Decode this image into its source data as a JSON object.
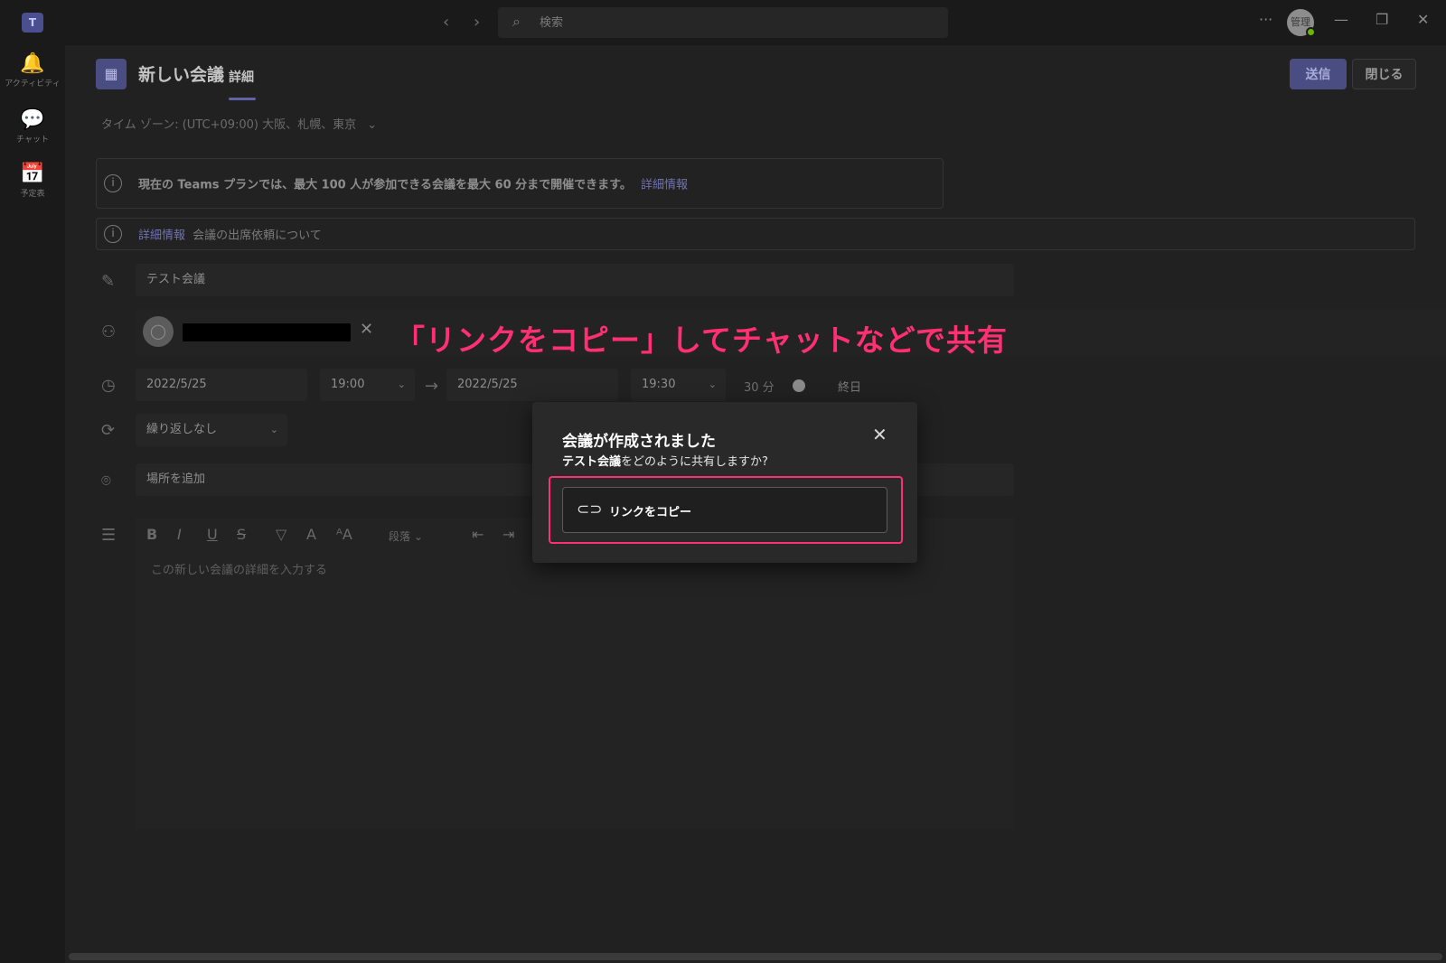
{
  "titlebar": {
    "app_logo": "T",
    "back_icon": "‹",
    "forward_icon": "›",
    "search_placeholder": "検索",
    "more_icon": "···",
    "avatar_initials": "管理",
    "minimize_icon": "—",
    "restore_icon": "❐",
    "close_icon": "✕"
  },
  "leftrail": {
    "items": [
      {
        "icon": "bell-icon",
        "glyph": "🔔",
        "label": "アクティビティ"
      },
      {
        "icon": "chat-icon",
        "glyph": "💬",
        "label": "チャット"
      },
      {
        "icon": "calendar-icon",
        "glyph": "📅",
        "label": "予定表"
      }
    ]
  },
  "header": {
    "title": "新しい会議",
    "tab": "詳細",
    "send_label": "送信",
    "close_label": "閉じる"
  },
  "timezone": "タイム ゾーン: (UTC+09:00) 大阪、札幌、東京",
  "notice_plan": {
    "prefix": "現在の Teams プランでは、最大 100 人が参加できる会議を最大 60 分まで開催できます。",
    "link": "詳細情報"
  },
  "notice_attendance": {
    "link": "詳細情報",
    "text": "会議の出席依頼について"
  },
  "form": {
    "title_value": "テスト会議",
    "start_date": "2022/5/25",
    "start_time": "19:00",
    "end_date": "2022/5/25",
    "end_time": "19:30",
    "duration": "30 分",
    "all_day": "終日",
    "repeat": "繰り返しなし",
    "location_placeholder": "場所を追加",
    "paragraph": "段落",
    "body_placeholder": "この新しい会議の詳細を入力する"
  },
  "annotation": "「リンクをコピー」してチャットなどで共有",
  "dialog": {
    "title": "会議が作成されました",
    "subtitle_bold": "テスト会議",
    "subtitle_rest": "をどのように共有しますか?",
    "copy_link_label": "リンクをコピー"
  },
  "colors": {
    "accent": "#6264a7",
    "annotation": "#ff2f73",
    "status_online": "#6bb700"
  }
}
